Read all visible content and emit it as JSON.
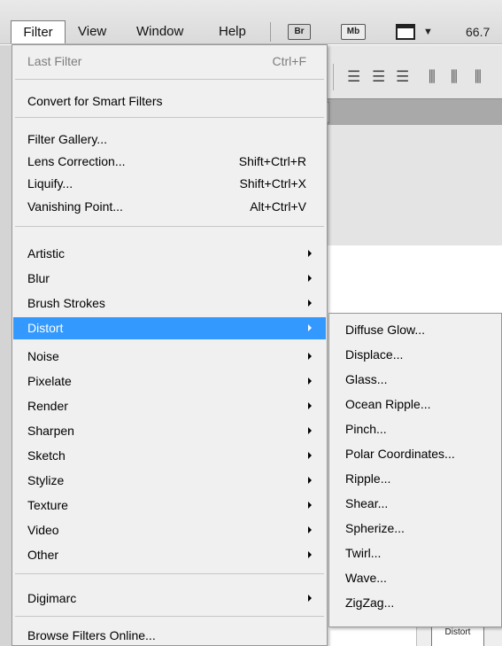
{
  "menubar": {
    "items": [
      "Filter",
      "View",
      "Window",
      "Help"
    ],
    "bridge_badge": "Br",
    "minibridge_badge": "Mb",
    "zoom": "66.7"
  },
  "canvas": {
    "doc_label": "Distort"
  },
  "filter_menu": {
    "last_filter": {
      "label": "Last Filter",
      "shortcut": "Ctrl+F"
    },
    "convert_smart": "Convert for Smart Filters",
    "filter_gallery": "Filter Gallery...",
    "lens_correction": {
      "label": "Lens Correction...",
      "shortcut": "Shift+Ctrl+R"
    },
    "liquify": {
      "label": "Liquify...",
      "shortcut": "Shift+Ctrl+X"
    },
    "vanishing_point": {
      "label": "Vanishing Point...",
      "shortcut": "Alt+Ctrl+V"
    },
    "categories": [
      "Artistic",
      "Blur",
      "Brush Strokes",
      "Distort",
      "Noise",
      "Pixelate",
      "Render",
      "Sharpen",
      "Sketch",
      "Stylize",
      "Texture",
      "Video",
      "Other"
    ],
    "highlighted": "Distort",
    "digimarc": "Digimarc",
    "browse_online": "Browse Filters Online..."
  },
  "distort_submenu": {
    "items": [
      "Diffuse Glow...",
      "Displace...",
      "Glass...",
      "Ocean Ripple...",
      "Pinch...",
      "Polar Coordinates...",
      "Ripple...",
      "Shear...",
      "Spherize...",
      "Twirl...",
      "Wave...",
      "ZigZag..."
    ]
  },
  "colors": {
    "highlight": "#3399ff",
    "menu_bg": "#f0f0f0",
    "disabled_text": "#7d7d7d"
  }
}
